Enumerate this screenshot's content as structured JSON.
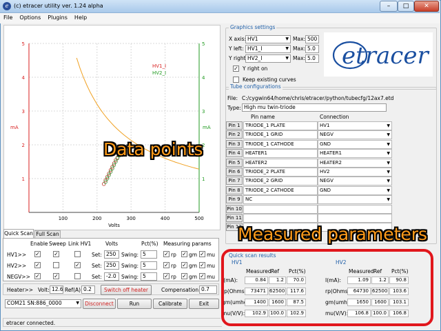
{
  "window": {
    "title": "(c) etracer utility ver. 1.24 alpha",
    "minimize": "–",
    "maximize": "□",
    "close": "✕"
  },
  "menu": [
    "File",
    "Options",
    "Plugins",
    "Help"
  ],
  "plot": {
    "left_axis_label": "mA",
    "right_axis_label": "mA",
    "x_axis_label": "Volts",
    "x_ticks": [
      "100",
      "200",
      "300",
      "400",
      "500"
    ],
    "y_ticks": [
      "1",
      "2",
      "3",
      "4",
      "5"
    ],
    "legend": [
      "HV1_I",
      "HV2_I"
    ],
    "colors": {
      "left": "#d81e1e",
      "right": "#1f9a1f",
      "curve": "#f0a020",
      "grid": "#d8d8d8"
    }
  },
  "chart_data": {
    "type": "scatter",
    "title": "",
    "xlabel": "Volts",
    "ylabel": "mA",
    "y2label": "mA",
    "xlim": [
      0,
      500
    ],
    "ylim": [
      0,
      5
    ],
    "series": [
      {
        "name": "HV1_I",
        "x": [
          220,
          225,
          230,
          235,
          240,
          245,
          250,
          255,
          260
        ],
        "y": [
          0.84,
          0.95,
          1.05,
          1.15,
          1.25,
          1.35,
          1.45,
          1.55,
          1.62
        ]
      },
      {
        "name": "HV2_I",
        "x": [
          225,
          230,
          235,
          240,
          245,
          250,
          255,
          260,
          265
        ],
        "y": [
          0.9,
          1.0,
          1.1,
          1.2,
          1.3,
          1.4,
          1.5,
          1.6,
          1.68
        ]
      }
    ]
  },
  "graphics_settings": {
    "title": "Graphics settings",
    "x_axis_label": "X axis:",
    "x_axis_value": "HV1",
    "x_max_label": "Max:",
    "x_max": "500",
    "y_left_label": "Y left:",
    "y_left_value": "HV1_I",
    "y_left_max_label": "Max:",
    "y_left_max": "5.0",
    "y_right_label": "Y right:",
    "y_right_value": "HV2_I",
    "y_right_max_label": "Max:",
    "y_right_max": "5.0",
    "y_right_on_label": "Y right on",
    "keep_curves_label": "Keep existing curves"
  },
  "logo": {
    "text": "etracer"
  },
  "tube": {
    "title": "Tube configurations",
    "file_label": "File:",
    "file_value": "C:/cygwin64/home/chris/etracer/python/tubecfg/12ax7.etd",
    "type_label": "Type:",
    "type_value": "High mu twin-triode",
    "col_pin": "Pin name",
    "col_conn": "Connection",
    "pins": [
      {
        "btn": "Pin 1",
        "name": "TRIODE_1 PLATE",
        "conn": "HV1"
      },
      {
        "btn": "Pin 2",
        "name": "TRIODE_1 GRID",
        "conn": "NEGV"
      },
      {
        "btn": "Pin 3",
        "name": "TRIODE_1 CATHODE",
        "conn": "GND"
      },
      {
        "btn": "Pin 4",
        "name": "HEATER1",
        "conn": "HEATER1"
      },
      {
        "btn": "Pin 5",
        "name": "HEATER2",
        "conn": "HEATER2"
      },
      {
        "btn": "Pin 6",
        "name": "TRIODE_2 PLATE",
        "conn": "HV2"
      },
      {
        "btn": "Pin 7",
        "name": "TRIODE_2 GRID",
        "conn": "NEGV"
      },
      {
        "btn": "Pin 8",
        "name": "TRIODE_2 CATHODE",
        "conn": "GND"
      },
      {
        "btn": "Pin 9",
        "name": "NC",
        "conn": ""
      },
      {
        "btn": "Pin 10",
        "name": "",
        "conn": ""
      },
      {
        "btn": "Pin 11",
        "name": "",
        "conn": ""
      },
      {
        "btn": "Pin 12",
        "name": "",
        "conn": ""
      }
    ]
  },
  "tabs": [
    "Quick Scan",
    "Full Scan"
  ],
  "scan": {
    "headers": {
      "enable": "Enable",
      "sweep": "Sweep",
      "link": "Link HV1",
      "volts": "Volts",
      "pct": "Pct(%)",
      "measuring": "Measuring params"
    },
    "rows": [
      {
        "label": "HV1>>",
        "set": "Set:",
        "volts": "250",
        "swing": "Swing:",
        "pct": "5",
        "enable": true,
        "sweep": true,
        "link": false
      },
      {
        "label": "HV2>>",
        "set": "Set:",
        "volts": "250",
        "swing": "Swing:",
        "pct": "5",
        "enable": true,
        "sweep": false,
        "link": true
      },
      {
        "label": "NEGV>>",
        "set": "Set:",
        "volts": "-2.0",
        "swing": "Swing:",
        "pct": "5",
        "enable": true,
        "sweep": true,
        "link": false
      }
    ],
    "params": [
      "rp",
      "gm",
      "mu"
    ]
  },
  "heater": {
    "label": "Heater>>",
    "volt_label": "Volt:",
    "volt": "12.6",
    "ref_label": "Ref(A):",
    "ref": "0.2",
    "switch": "Switch off heater",
    "comp_label": "Compensation:",
    "comp": "0.7"
  },
  "device": {
    "port": "COM21 SN:886_0000"
  },
  "buttons": {
    "disconnect": "Disconnect",
    "run": "Run",
    "calibrate": "Calibrate",
    "exit": "Exit"
  },
  "status": "etracer connected.",
  "results": {
    "title": "Quick scan results",
    "hv1_label": "HV1",
    "hv2_label": "HV2",
    "headers": [
      "Measured",
      "Ref",
      "Pct(%)"
    ],
    "rows": [
      {
        "label": "I(mA):",
        "hv1": [
          "0.84",
          "1.2",
          "70.0"
        ],
        "hv2": [
          "1.09",
          "1.2",
          "90.8"
        ]
      },
      {
        "label": "rp(Ohms):",
        "hv1": [
          "73471",
          "62500",
          "117.6"
        ],
        "hv2": [
          "64730",
          "62500",
          "103.6"
        ]
      },
      {
        "label": "gm(umhos):",
        "hv1": [
          "1400",
          "1600",
          "87.5"
        ],
        "hv2": [
          "1650",
          "1600",
          "103.1"
        ]
      },
      {
        "label": "mu(V/V):",
        "hv1": [
          "102.9",
          "100.0",
          "102.9"
        ],
        "hv2": [
          "106.8",
          "100.0",
          "106.8"
        ]
      }
    ]
  },
  "annotations": {
    "data_points": "Data points",
    "measured_parameters": "Measured parameters"
  }
}
